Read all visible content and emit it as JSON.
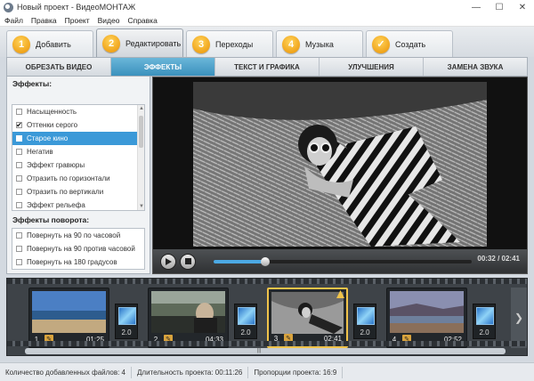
{
  "window": {
    "title": "Новый проект - ВидеоМОНТАЖ"
  },
  "menu": [
    "Файл",
    "Правка",
    "Проект",
    "Видео",
    "Справка"
  ],
  "steps": [
    {
      "num": "1",
      "label": "Добавить"
    },
    {
      "num": "2",
      "label": "Редактировать"
    },
    {
      "num": "3",
      "label": "Переходы"
    },
    {
      "num": "4",
      "label": "Музыка"
    },
    {
      "num": "",
      "label": "Создать"
    }
  ],
  "subtabs": [
    "ОБРЕЗАТЬ ВИДЕО",
    "ЭФФЕКТЫ",
    "ТЕКСТ И ГРАФИКА",
    "УЛУЧШЕНИЯ",
    "ЗАМЕНА ЗВУКА"
  ],
  "effects": {
    "title": "Эффекты:",
    "items": [
      {
        "label": "Насыщенность",
        "checked": false
      },
      {
        "label": "Оттенки серого",
        "checked": true
      },
      {
        "label": "Старое кино",
        "checked": false
      },
      {
        "label": "Негатив",
        "checked": false
      },
      {
        "label": "Эффект гравюры",
        "checked": false
      },
      {
        "label": "Отразить по горизонтали",
        "checked": false
      },
      {
        "label": "Отразить по вертикали",
        "checked": false
      },
      {
        "label": "Эффект рельефа",
        "checked": false
      }
    ]
  },
  "rotation": {
    "title": "Эффекты поворота:",
    "items": [
      {
        "label": "Повернуть на 90 по часовой"
      },
      {
        "label": "Повернуть на 90 против часовой"
      },
      {
        "label": "Повернуть на 180 градусов"
      }
    ]
  },
  "player": {
    "timecode": "00:32 / 02:41",
    "progress": 0.2
  },
  "clips": [
    {
      "index": "1",
      "duration": "01:25"
    },
    {
      "index": "2",
      "duration": "04:33"
    },
    {
      "index": "3",
      "duration": "02:41"
    },
    {
      "index": "4",
      "duration": "02:52"
    }
  ],
  "transitions": [
    "2.0",
    "2.0",
    "2.0",
    "2.0"
  ],
  "status": {
    "files": "Количество добавленных файлов: 4",
    "duration": "Длительность проекта:  00:11:26",
    "ratio": "Пропорции проекта:  16:9"
  },
  "colors": {
    "accent": "#3b91bd",
    "step_badge": "#f0a41b",
    "selected_clip": "#f0c34a"
  }
}
